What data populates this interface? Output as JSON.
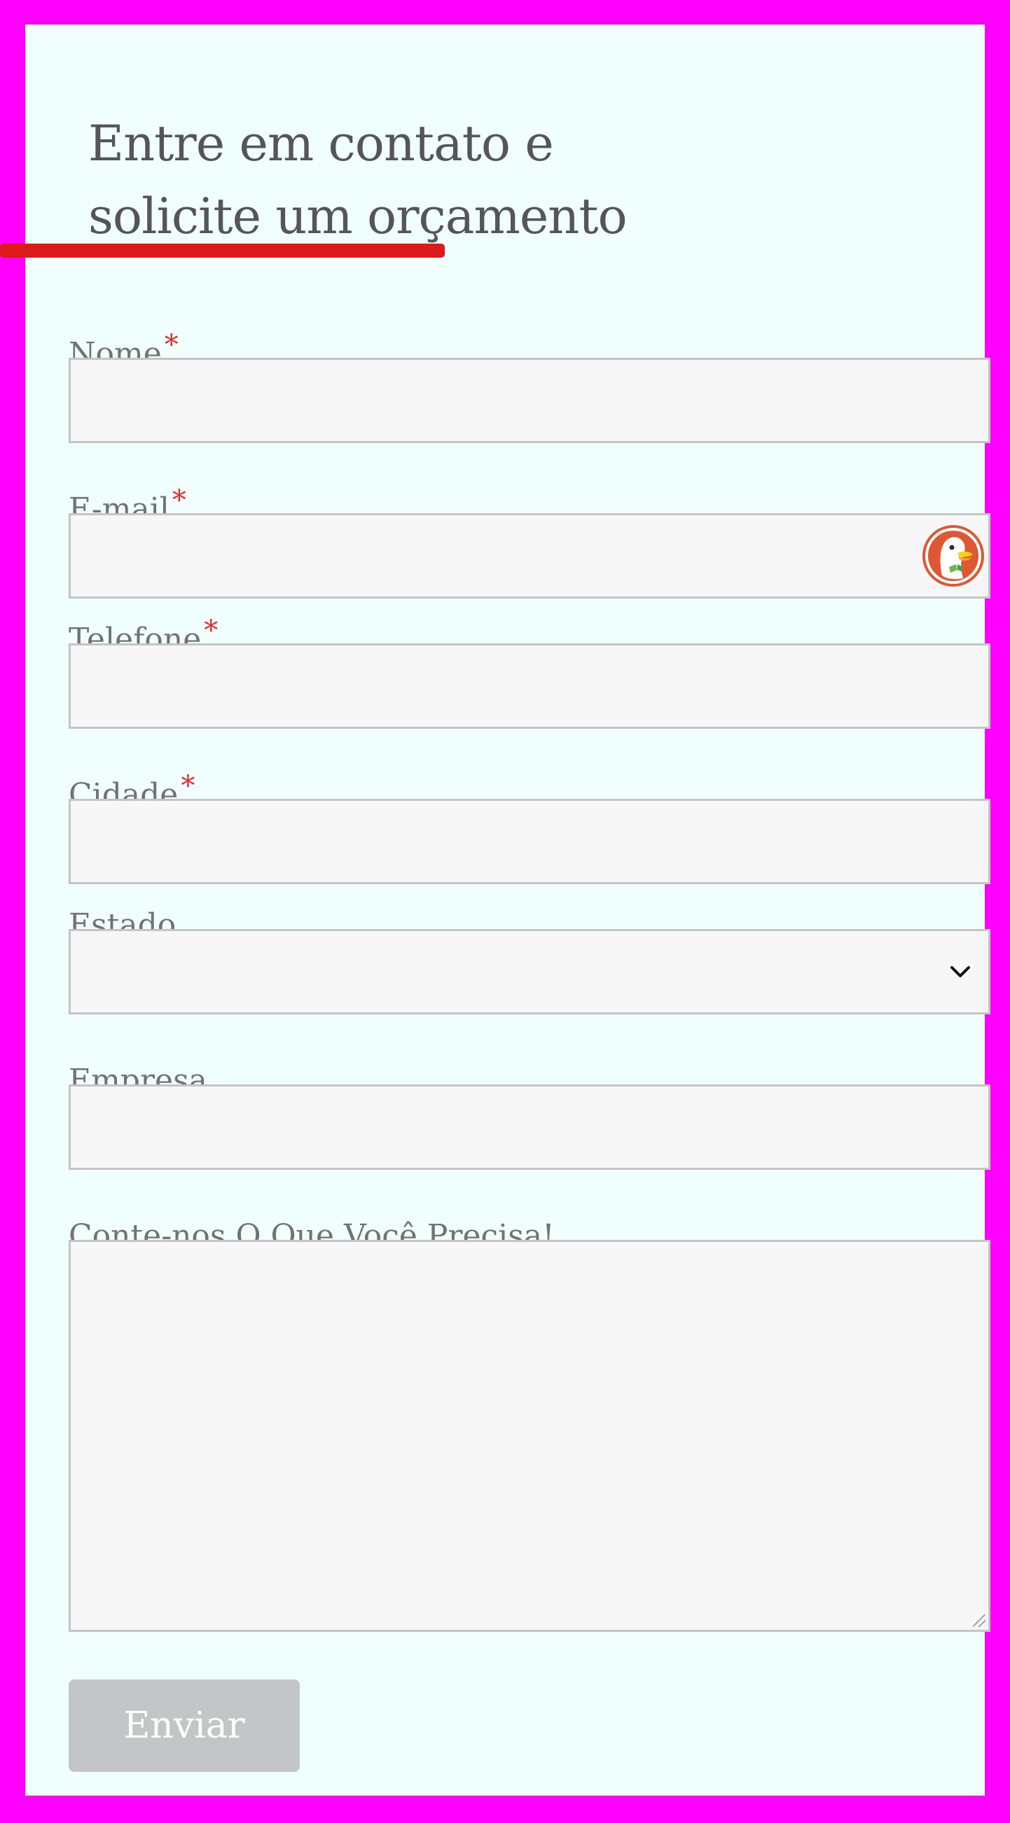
{
  "header": {
    "title_line1": "Entre em contato e",
    "title_line2": "solicite um orçamento"
  },
  "form": {
    "required_marker": "*",
    "fields": {
      "nome": {
        "label": "Nome",
        "value": ""
      },
      "email": {
        "label": "E-mail",
        "value": ""
      },
      "telefone": {
        "label": "Telefone",
        "value": ""
      },
      "cidade": {
        "label": "Cidade",
        "value": ""
      },
      "estado": {
        "label": "Estado",
        "selected": ""
      },
      "empresa": {
        "label": "Empresa",
        "value": ""
      },
      "mensagem": {
        "label": "Conte-nos O Que Você Precisa!",
        "value": ""
      }
    },
    "submit_label": "Enviar"
  },
  "colors": {
    "page_border": "#ff00ff",
    "panel_bg": "#f0fffe",
    "accent_underline": "#dc1a1a",
    "required": "#e03030",
    "button_bg": "#c3c6c6"
  },
  "icons": {
    "email_autofill": "duckduckgo-icon",
    "select_arrow": "chevron-down-icon",
    "textarea_resize": "resize-handle-icon"
  }
}
